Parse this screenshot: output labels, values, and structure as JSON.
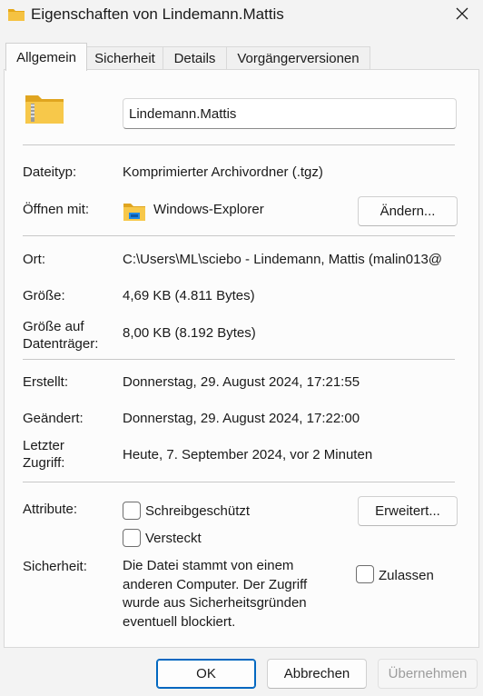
{
  "window": {
    "title": "Eigenschaften von Lindemann.Mattis",
    "close_icon": "close-icon"
  },
  "tabs": [
    {
      "label": "Allgemein",
      "active": true
    },
    {
      "label": "Sicherheit",
      "active": false
    },
    {
      "label": "Details",
      "active": false
    },
    {
      "label": "Vorgängerversionen",
      "active": false
    }
  ],
  "general": {
    "file_icon": "zip-folder-icon",
    "name": "Lindemann.Mattis",
    "type_label": "Dateityp:",
    "type_value": "Komprimierter Archivordner (.tgz)",
    "open_with_label": "Öffnen mit:",
    "open_with_icon": "explorer-folder-icon",
    "open_with_value": "Windows-Explorer",
    "change_button": "Ändern...",
    "location_label": "Ort:",
    "location_value": "C:\\Users\\ML\\sciebo - Lindemann, Mattis (malin013@",
    "size_label": "Größe:",
    "size_value": "4,69 KB (4.811 Bytes)",
    "size_on_disk_label": "Größe auf\nDatenträger:",
    "size_on_disk_value": "8,00 KB (8.192 Bytes)",
    "created_label": "Erstellt:",
    "created_value": "Donnerstag, 29. August 2024, 17:21:55",
    "modified_label": "Geändert:",
    "modified_value": "Donnerstag, 29. August 2024, 17:22:00",
    "accessed_label": "Letzter\nZugriff:",
    "accessed_value": "Heute, 7. September 2024, vor 2 Minuten",
    "attributes_label": "Attribute:",
    "readonly_label": "Schreibgeschützt",
    "readonly_checked": false,
    "hidden_label": "Versteckt",
    "hidden_checked": false,
    "advanced_button": "Erweitert...",
    "security_label": "Sicherheit:",
    "security_text": "Die Datei stammt von einem\nanderen Computer. Der Zugriff\nwurde aus Sicherheitsgründen\neventuell blockiert.",
    "unblock_label": "Zulassen",
    "unblock_checked": false
  },
  "footer": {
    "ok": "OK",
    "cancel": "Abbrechen",
    "apply": "Übernehmen"
  },
  "colors": {
    "accent": "#0067c0",
    "folder_yellow": "#f5c242",
    "background": "#f3f3f3",
    "panel": "#fcfcfc"
  }
}
